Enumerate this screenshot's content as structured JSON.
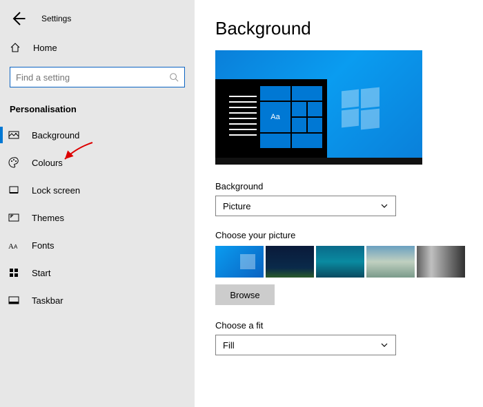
{
  "header": {
    "title": "Settings"
  },
  "home": {
    "label": "Home"
  },
  "search": {
    "placeholder": "Find a setting"
  },
  "section": {
    "title": "Personalisation"
  },
  "sidebar": {
    "items": [
      {
        "label": "Background"
      },
      {
        "label": "Colours"
      },
      {
        "label": "Lock screen"
      },
      {
        "label": "Themes"
      },
      {
        "label": "Fonts"
      },
      {
        "label": "Start"
      },
      {
        "label": "Taskbar"
      }
    ]
  },
  "page": {
    "title": "Background"
  },
  "preview": {
    "sample_text": "Aa"
  },
  "background_select": {
    "label": "Background",
    "value": "Picture"
  },
  "picture_section": {
    "label": "Choose your picture",
    "browse": "Browse"
  },
  "fit_select": {
    "label": "Choose a fit",
    "value": "Fill"
  }
}
